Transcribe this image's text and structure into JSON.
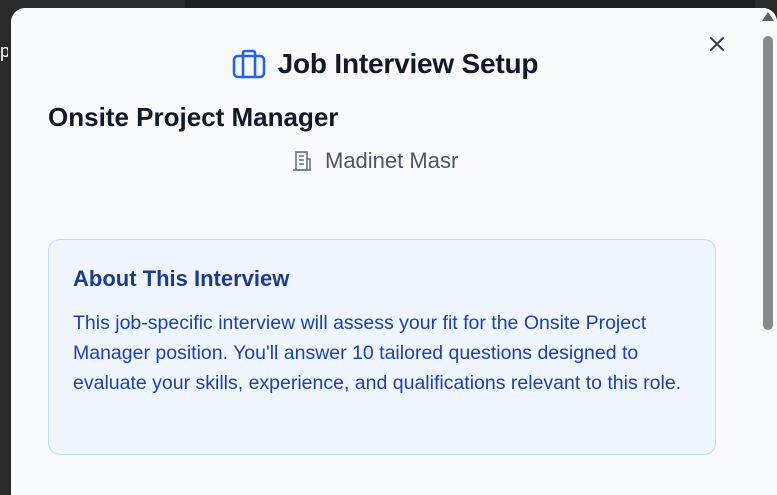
{
  "modal": {
    "title": "Job Interview Setup",
    "title_icon": "briefcase-icon",
    "close_icon": "close-icon"
  },
  "job": {
    "title": "Onsite Project Manager",
    "location": "Madinet Masr",
    "location_icon": "building-icon"
  },
  "about": {
    "heading": "About This Interview",
    "description": "This job-specific interview will assess your fit for the Onsite Project Manager position. You'll answer 10 tailored questions designed to evaluate your skills, experience, and qualifications relevant to this role."
  },
  "colors": {
    "accent": "#2563eb",
    "about_bg": "#eff6ff",
    "about_border": "#bfdbfe",
    "about_heading": "#1e3a8a",
    "about_text": "#1e40af"
  }
}
